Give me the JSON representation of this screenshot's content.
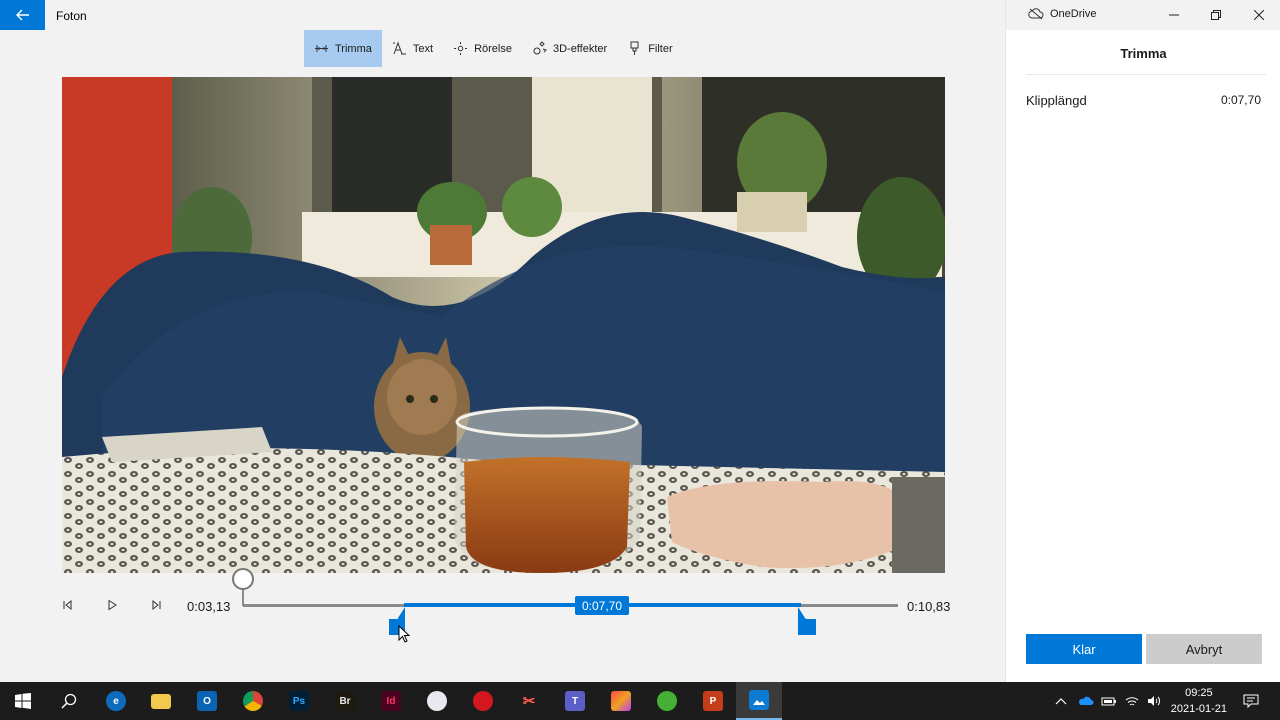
{
  "app": {
    "title": "Foton"
  },
  "toolbar": {
    "items": [
      {
        "label": "Trimma",
        "icon": "trim-icon",
        "active": true
      },
      {
        "label": "Text",
        "icon": "text-icon"
      },
      {
        "label": "Rörelse",
        "icon": "motion-icon"
      },
      {
        "label": "3D-effekter",
        "icon": "3d-effects-icon"
      },
      {
        "label": "Filter",
        "icon": "filter-icon"
      }
    ]
  },
  "playback": {
    "current_time": "0:03,13",
    "end_time": "0:10,83",
    "selection_length": "0:07,70",
    "playhead_fraction": 0.0,
    "trim_start_fraction": 0.246,
    "trim_end_fraction": 0.852
  },
  "panel": {
    "onedrive_label": "OneDrive",
    "title": "Trimma",
    "property_label": "Klipplängd",
    "property_value": "0:07,70",
    "done_label": "Klar",
    "cancel_label": "Avbryt"
  },
  "taskbar": {
    "apps": [
      "start-icon",
      "search-icon",
      "edge-icon",
      "file-explorer-icon",
      "outlook-icon",
      "chrome-icon",
      "photoshop-icon",
      "bridge-icon",
      "indesign-icon",
      "app-icon",
      "opera-icon",
      "snip-icon",
      "teams-icon",
      "creative-cloud-icon",
      "green-app-icon",
      "powerpoint-icon",
      "photos-icon"
    ],
    "ps_label": "Ps",
    "br_label": "Br",
    "id_label": "Id",
    "ppt_label": "P",
    "time": "09:25",
    "date": "2021-01-21"
  },
  "colors": {
    "accent": "#0078d7",
    "taskbar": "#1c1c1c",
    "selected_tool": "#a6caf0"
  }
}
